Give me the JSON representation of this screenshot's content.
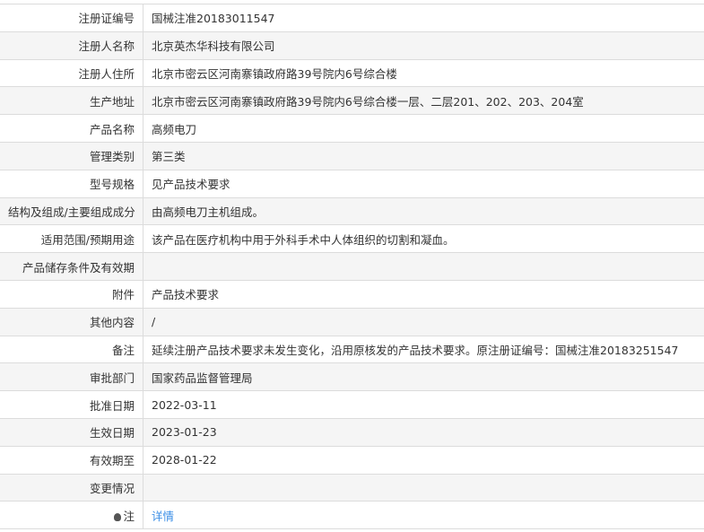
{
  "rows": [
    {
      "label": "注册证编号",
      "value": "国械注准20183011547"
    },
    {
      "label": "注册人名称",
      "value": "北京英杰华科技有限公司"
    },
    {
      "label": "注册人住所",
      "value": "北京市密云区河南寨镇政府路39号院内6号综合楼"
    },
    {
      "label": "生产地址",
      "value": "北京市密云区河南寨镇政府路39号院内6号综合楼一层、二层201、202、203、204室"
    },
    {
      "label": "产品名称",
      "value": "高频电刀"
    },
    {
      "label": "管理类别",
      "value": "第三类"
    },
    {
      "label": "型号规格",
      "value": "见产品技术要求"
    },
    {
      "label": "结构及组成/主要组成成分",
      "value": "由高频电刀主机组成。"
    },
    {
      "label": "适用范围/预期用途",
      "value": "该产品在医疗机构中用于外科手术中人体组织的切割和凝血。"
    },
    {
      "label": "产品储存条件及有效期",
      "value": ""
    },
    {
      "label": "附件",
      "value": "产品技术要求"
    },
    {
      "label": "其他内容",
      "value": "/"
    },
    {
      "label": "备注",
      "value": "延续注册产品技术要求未发生变化，沿用原核发的产品技术要求。原注册证编号：国械注准20183251547"
    },
    {
      "label": "审批部门",
      "value": "国家药品监督管理局"
    },
    {
      "label": "批准日期",
      "value": "2022-03-11"
    },
    {
      "label": "生效日期",
      "value": "2023-01-23"
    },
    {
      "label": "有效期至",
      "value": "2028-01-22"
    },
    {
      "label": "变更情况",
      "value": ""
    }
  ],
  "note": {
    "label": "注",
    "icon": "bulb-icon",
    "link": "详情",
    "link_color": "#3a8ee6"
  }
}
